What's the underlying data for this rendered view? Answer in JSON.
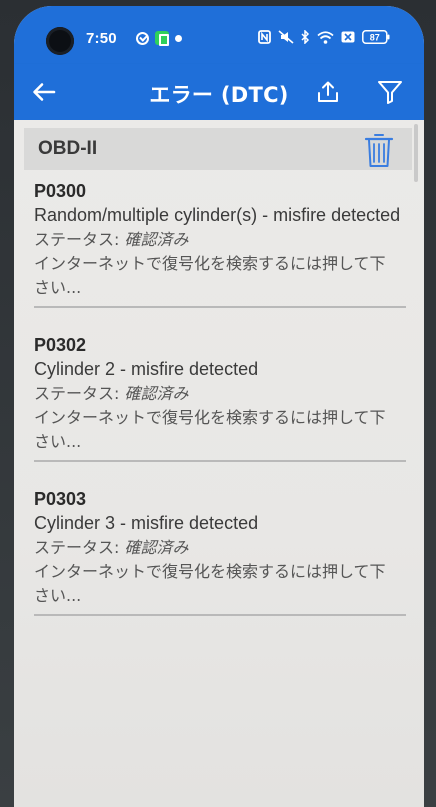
{
  "status_bar": {
    "time": "7:50",
    "battery": "87"
  },
  "app_bar": {
    "title": "エラー (DTC)",
    "back_icon": "back-arrow-icon",
    "share_icon": "share-icon",
    "filter_icon": "filter-icon"
  },
  "section": {
    "title": "OBD-II",
    "delete_icon": "trash-icon"
  },
  "dtc_items": [
    {
      "code": "P0300",
      "description": "Random/multiple cylinder(s) - misfire detected",
      "status_label": "ステータス:",
      "status_value": "確認済み",
      "hint": "インターネットで復号化を検索するには押して下さい..."
    },
    {
      "code": "P0302",
      "description": "Cylinder 2 - misfire detected",
      "status_label": "ステータス:",
      "status_value": "確認済み",
      "hint": "インターネットで復号化を検索するには押して下さい..."
    },
    {
      "code": "P0303",
      "description": "Cylinder 3 - misfire detected",
      "status_label": "ステータス:",
      "status_value": "確認済み",
      "hint": "インターネットで復号化を検索するには押して下さい..."
    }
  ],
  "colors": {
    "app_bar": "#1f6fd9",
    "trash_icon": "#3a7de0",
    "background": "#ebeae8"
  }
}
